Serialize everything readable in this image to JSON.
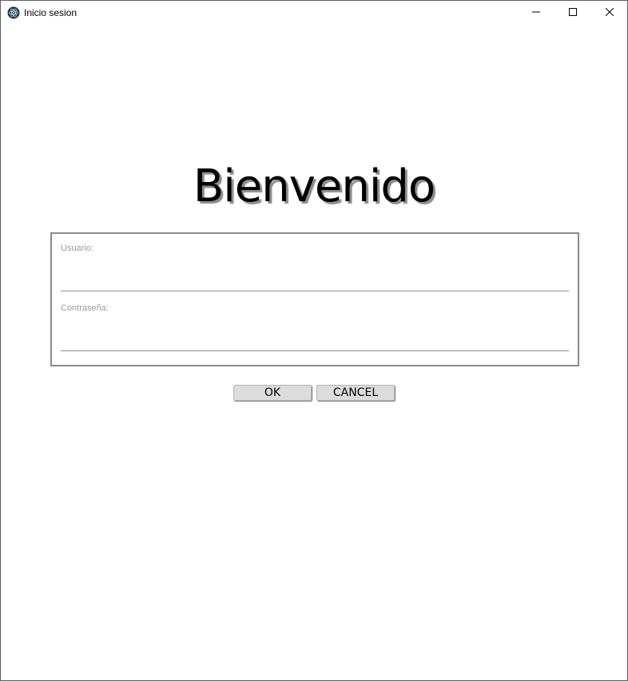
{
  "window": {
    "title": "Inicio sesion",
    "icon": "electron-app-icon",
    "controls": {
      "minimize": "minimize-icon",
      "maximize": "maximize-icon",
      "close": "close-icon"
    }
  },
  "main": {
    "heading": "Bienvenido",
    "form": {
      "username_label": "Usuario:",
      "username_value": "",
      "password_label": "Contraseña:",
      "password_value": ""
    },
    "buttons": {
      "ok_label": "OK",
      "cancel_label": "CANCEL"
    }
  },
  "colors": {
    "background": "#ffffff",
    "button_bg": "#dcdcdc",
    "label": "#9a9a9a",
    "border": "#8a8a8a"
  }
}
